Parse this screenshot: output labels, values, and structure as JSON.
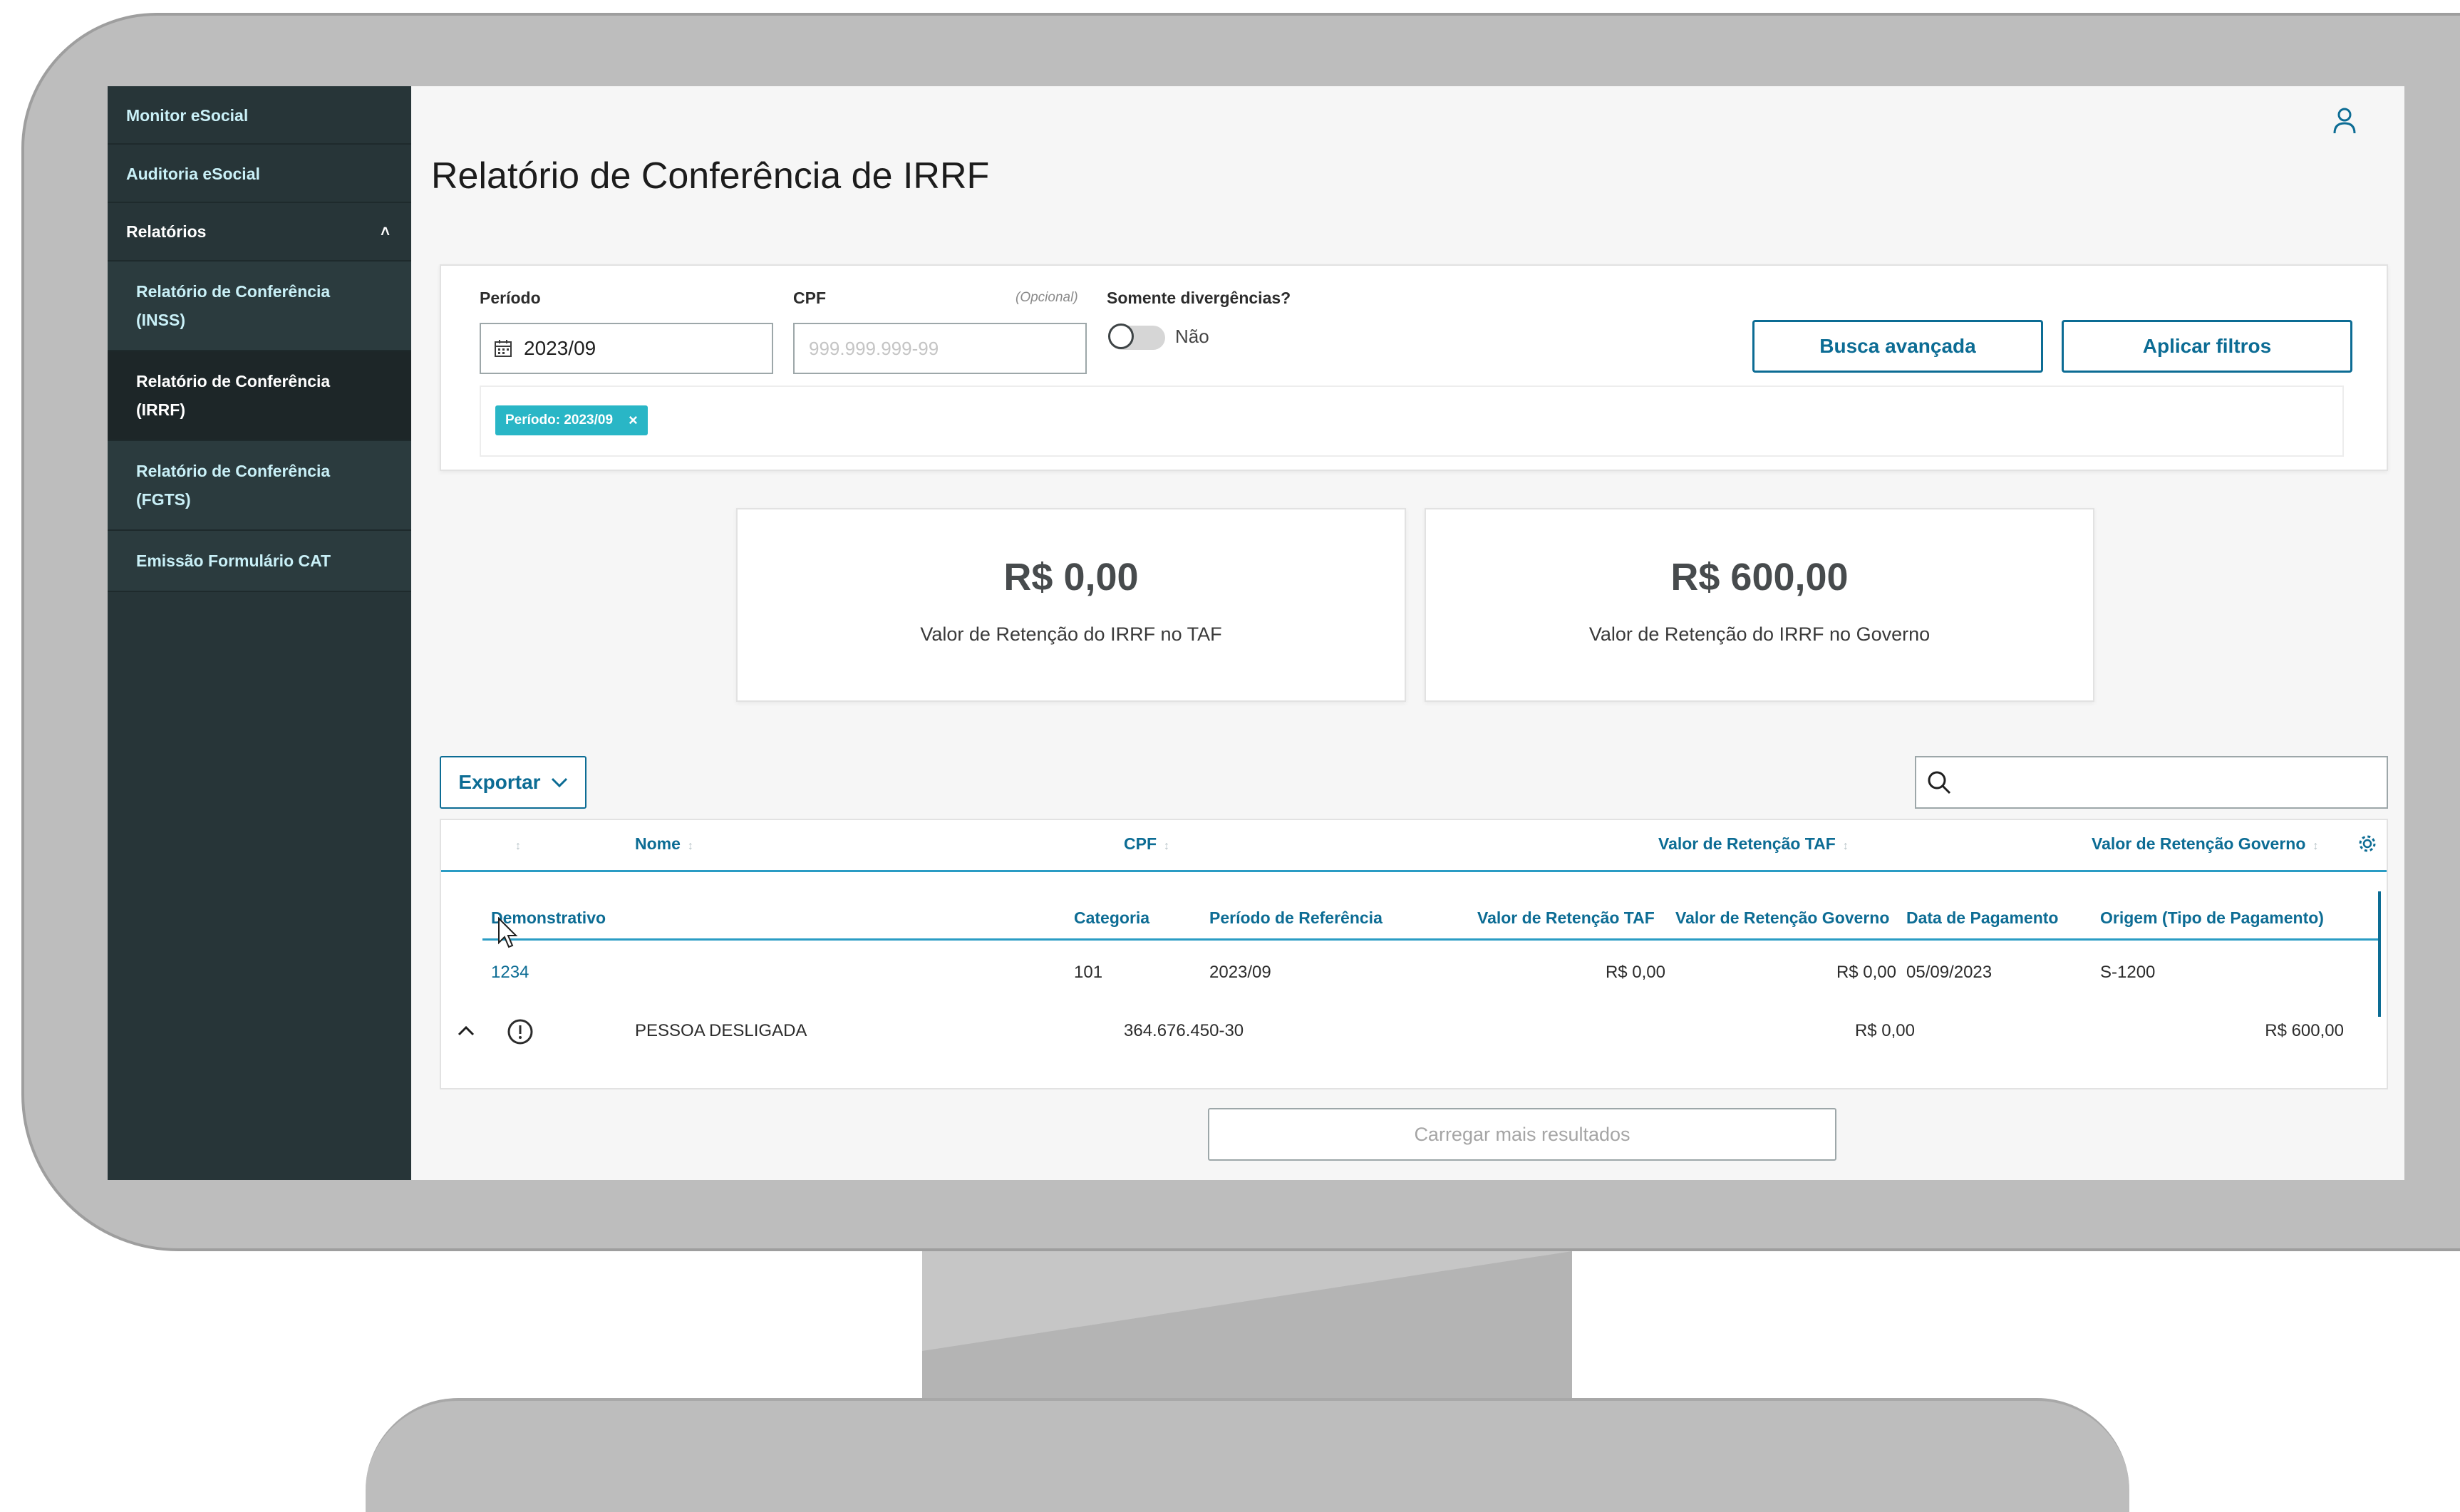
{
  "sidebar": {
    "items": [
      {
        "label": "Monitor eSocial"
      },
      {
        "label": "Auditoria eSocial"
      }
    ],
    "group": {
      "label": "Relatórios",
      "icon": "chevron-up-icon"
    },
    "subitems": [
      {
        "label": "Relatório de Conferência (INSS)"
      },
      {
        "label": "Relatório de Conferência (IRRF)",
        "active": true
      },
      {
        "label": "Relatório de Conferência (FGTS)"
      },
      {
        "label": "Emissão Formulário CAT"
      }
    ]
  },
  "header": {
    "title": "Relatório de Conferência de IRRF",
    "user_icon": "user-icon"
  },
  "filters": {
    "periodo": {
      "label": "Período",
      "value": "2023/09",
      "icon": "calendar-icon"
    },
    "cpf": {
      "label": "CPF",
      "optional": "(Opcional)",
      "placeholder": "999.999.999-99"
    },
    "divergencias": {
      "label": "Somente divergências?",
      "value": "Não"
    },
    "busca_avancada": "Busca avançada",
    "aplicar": "Aplicar filtros",
    "tag": {
      "label": "Período: 2023/09",
      "close": "×"
    }
  },
  "cards": [
    {
      "value": "R$ 0,00",
      "label": "Valor de Retenção do IRRF no TAF"
    },
    {
      "value": "R$ 600,00",
      "label": "Valor de Retenção do IRRF no Governo"
    }
  ],
  "toolbar": {
    "export_label": "Exportar",
    "search_placeholder": ""
  },
  "table": {
    "columns": [
      "Nome",
      "CPF",
      "Valor de Retenção TAF",
      "Valor de Retenção Governo"
    ],
    "detail": {
      "columns": [
        "Demonstrativo",
        "Categoria",
        "Período de Referência",
        "Valor de Retenção TAF",
        "Valor de Retenção Governo",
        "Data de Pagamento",
        "Origem (Tipo de Pagamento)"
      ],
      "rows": [
        {
          "demonstrativo": "1234",
          "categoria": "101",
          "periodo": "2023/09",
          "taf": "R$ 0,00",
          "governo": "R$ 0,00",
          "data": "05/09/2023",
          "origem": "S-1200"
        }
      ]
    },
    "rows": [
      {
        "nome": "PESSOA DESLIGADA",
        "cpf": "364.676.450-30",
        "taf": "R$ 0,00",
        "governo": "R$ 600,00"
      }
    ]
  },
  "load_more": "Carregar mais resultados",
  "colors": {
    "sidebar": "#273538",
    "accent": "#0c6c94",
    "tag": "#29b6c6"
  }
}
